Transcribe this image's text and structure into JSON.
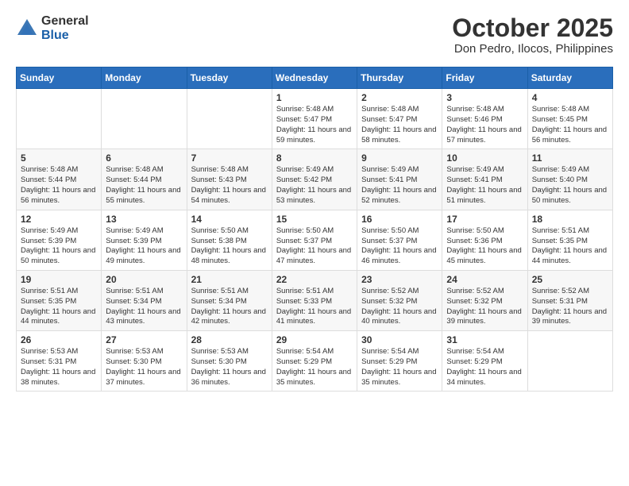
{
  "header": {
    "logo_general": "General",
    "logo_blue": "Blue",
    "month_title": "October 2025",
    "location": "Don Pedro, Ilocos, Philippines"
  },
  "days_of_week": [
    "Sunday",
    "Monday",
    "Tuesday",
    "Wednesday",
    "Thursday",
    "Friday",
    "Saturday"
  ],
  "weeks": [
    [
      {
        "day": "",
        "sunrise": "",
        "sunset": "",
        "daylight": ""
      },
      {
        "day": "",
        "sunrise": "",
        "sunset": "",
        "daylight": ""
      },
      {
        "day": "",
        "sunrise": "",
        "sunset": "",
        "daylight": ""
      },
      {
        "day": "1",
        "sunrise": "Sunrise: 5:48 AM",
        "sunset": "Sunset: 5:47 PM",
        "daylight": "Daylight: 11 hours and 59 minutes."
      },
      {
        "day": "2",
        "sunrise": "Sunrise: 5:48 AM",
        "sunset": "Sunset: 5:47 PM",
        "daylight": "Daylight: 11 hours and 58 minutes."
      },
      {
        "day": "3",
        "sunrise": "Sunrise: 5:48 AM",
        "sunset": "Sunset: 5:46 PM",
        "daylight": "Daylight: 11 hours and 57 minutes."
      },
      {
        "day": "4",
        "sunrise": "Sunrise: 5:48 AM",
        "sunset": "Sunset: 5:45 PM",
        "daylight": "Daylight: 11 hours and 56 minutes."
      }
    ],
    [
      {
        "day": "5",
        "sunrise": "Sunrise: 5:48 AM",
        "sunset": "Sunset: 5:44 PM",
        "daylight": "Daylight: 11 hours and 56 minutes."
      },
      {
        "day": "6",
        "sunrise": "Sunrise: 5:48 AM",
        "sunset": "Sunset: 5:44 PM",
        "daylight": "Daylight: 11 hours and 55 minutes."
      },
      {
        "day": "7",
        "sunrise": "Sunrise: 5:48 AM",
        "sunset": "Sunset: 5:43 PM",
        "daylight": "Daylight: 11 hours and 54 minutes."
      },
      {
        "day": "8",
        "sunrise": "Sunrise: 5:49 AM",
        "sunset": "Sunset: 5:42 PM",
        "daylight": "Daylight: 11 hours and 53 minutes."
      },
      {
        "day": "9",
        "sunrise": "Sunrise: 5:49 AM",
        "sunset": "Sunset: 5:41 PM",
        "daylight": "Daylight: 11 hours and 52 minutes."
      },
      {
        "day": "10",
        "sunrise": "Sunrise: 5:49 AM",
        "sunset": "Sunset: 5:41 PM",
        "daylight": "Daylight: 11 hours and 51 minutes."
      },
      {
        "day": "11",
        "sunrise": "Sunrise: 5:49 AM",
        "sunset": "Sunset: 5:40 PM",
        "daylight": "Daylight: 11 hours and 50 minutes."
      }
    ],
    [
      {
        "day": "12",
        "sunrise": "Sunrise: 5:49 AM",
        "sunset": "Sunset: 5:39 PM",
        "daylight": "Daylight: 11 hours and 50 minutes."
      },
      {
        "day": "13",
        "sunrise": "Sunrise: 5:49 AM",
        "sunset": "Sunset: 5:39 PM",
        "daylight": "Daylight: 11 hours and 49 minutes."
      },
      {
        "day": "14",
        "sunrise": "Sunrise: 5:50 AM",
        "sunset": "Sunset: 5:38 PM",
        "daylight": "Daylight: 11 hours and 48 minutes."
      },
      {
        "day": "15",
        "sunrise": "Sunrise: 5:50 AM",
        "sunset": "Sunset: 5:37 PM",
        "daylight": "Daylight: 11 hours and 47 minutes."
      },
      {
        "day": "16",
        "sunrise": "Sunrise: 5:50 AM",
        "sunset": "Sunset: 5:37 PM",
        "daylight": "Daylight: 11 hours and 46 minutes."
      },
      {
        "day": "17",
        "sunrise": "Sunrise: 5:50 AM",
        "sunset": "Sunset: 5:36 PM",
        "daylight": "Daylight: 11 hours and 45 minutes."
      },
      {
        "day": "18",
        "sunrise": "Sunrise: 5:51 AM",
        "sunset": "Sunset: 5:35 PM",
        "daylight": "Daylight: 11 hours and 44 minutes."
      }
    ],
    [
      {
        "day": "19",
        "sunrise": "Sunrise: 5:51 AM",
        "sunset": "Sunset: 5:35 PM",
        "daylight": "Daylight: 11 hours and 44 minutes."
      },
      {
        "day": "20",
        "sunrise": "Sunrise: 5:51 AM",
        "sunset": "Sunset: 5:34 PM",
        "daylight": "Daylight: 11 hours and 43 minutes."
      },
      {
        "day": "21",
        "sunrise": "Sunrise: 5:51 AM",
        "sunset": "Sunset: 5:34 PM",
        "daylight": "Daylight: 11 hours and 42 minutes."
      },
      {
        "day": "22",
        "sunrise": "Sunrise: 5:51 AM",
        "sunset": "Sunset: 5:33 PM",
        "daylight": "Daylight: 11 hours and 41 minutes."
      },
      {
        "day": "23",
        "sunrise": "Sunrise: 5:52 AM",
        "sunset": "Sunset: 5:32 PM",
        "daylight": "Daylight: 11 hours and 40 minutes."
      },
      {
        "day": "24",
        "sunrise": "Sunrise: 5:52 AM",
        "sunset": "Sunset: 5:32 PM",
        "daylight": "Daylight: 11 hours and 39 minutes."
      },
      {
        "day": "25",
        "sunrise": "Sunrise: 5:52 AM",
        "sunset": "Sunset: 5:31 PM",
        "daylight": "Daylight: 11 hours and 39 minutes."
      }
    ],
    [
      {
        "day": "26",
        "sunrise": "Sunrise: 5:53 AM",
        "sunset": "Sunset: 5:31 PM",
        "daylight": "Daylight: 11 hours and 38 minutes."
      },
      {
        "day": "27",
        "sunrise": "Sunrise: 5:53 AM",
        "sunset": "Sunset: 5:30 PM",
        "daylight": "Daylight: 11 hours and 37 minutes."
      },
      {
        "day": "28",
        "sunrise": "Sunrise: 5:53 AM",
        "sunset": "Sunset: 5:30 PM",
        "daylight": "Daylight: 11 hours and 36 minutes."
      },
      {
        "day": "29",
        "sunrise": "Sunrise: 5:54 AM",
        "sunset": "Sunset: 5:29 PM",
        "daylight": "Daylight: 11 hours and 35 minutes."
      },
      {
        "day": "30",
        "sunrise": "Sunrise: 5:54 AM",
        "sunset": "Sunset: 5:29 PM",
        "daylight": "Daylight: 11 hours and 35 minutes."
      },
      {
        "day": "31",
        "sunrise": "Sunrise: 5:54 AM",
        "sunset": "Sunset: 5:29 PM",
        "daylight": "Daylight: 11 hours and 34 minutes."
      },
      {
        "day": "",
        "sunrise": "",
        "sunset": "",
        "daylight": ""
      }
    ]
  ]
}
